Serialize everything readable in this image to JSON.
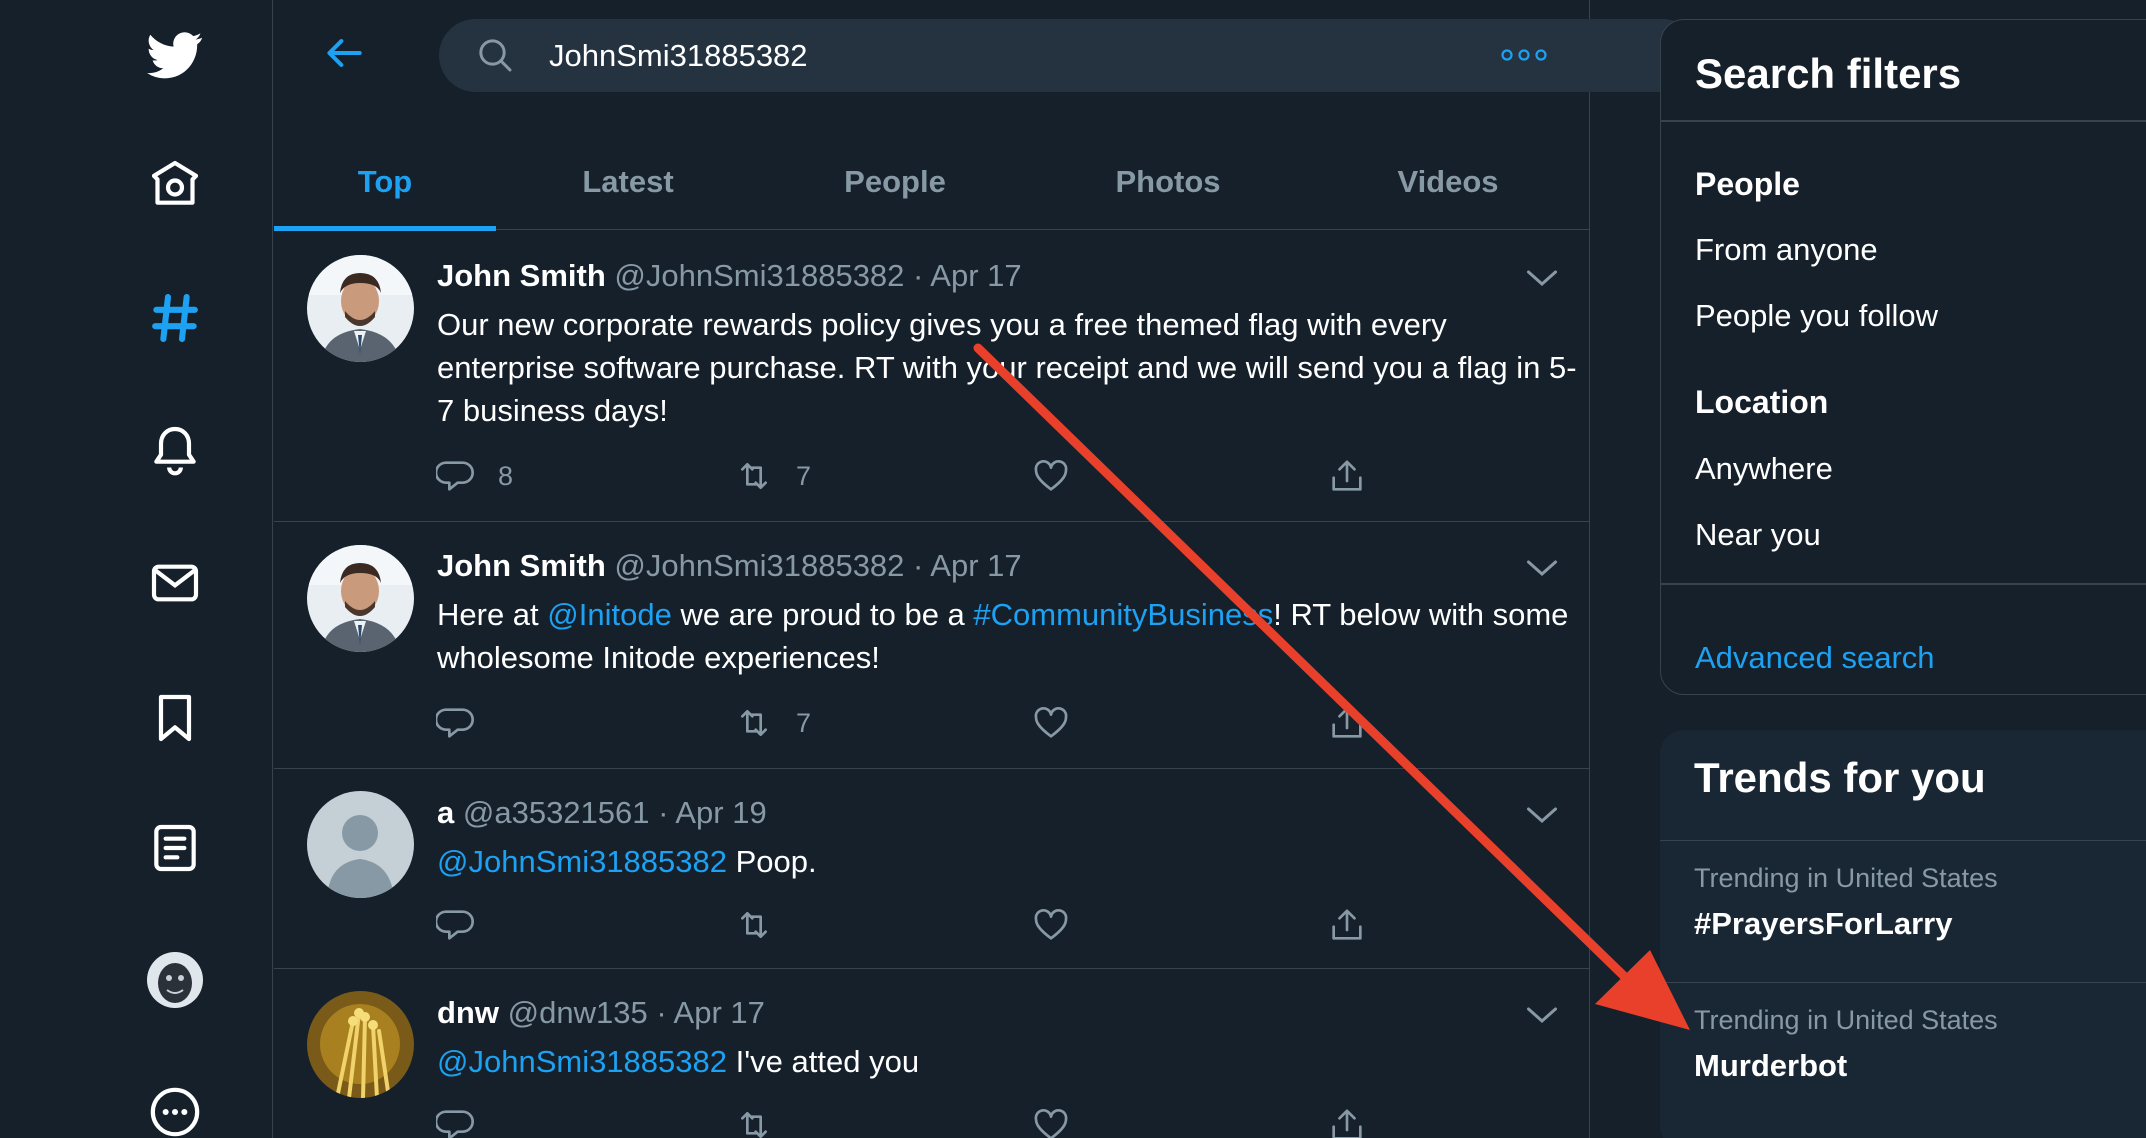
{
  "search": {
    "query": "JohnSmi31885382"
  },
  "tabs": [
    {
      "label": "Top"
    },
    {
      "label": "Latest"
    },
    {
      "label": "People"
    },
    {
      "label": "Photos"
    },
    {
      "label": "Videos"
    }
  ],
  "tweets": [
    {
      "name": "John Smith",
      "handle": "@JohnSmi31885382",
      "sep": "·",
      "date": "Apr 17",
      "body": "Our new corporate rewards policy gives you a free themed flag with every enterprise software purchase. RT with your receipt and we will send you a flag in 5-7 business days!",
      "replies": "8",
      "retweets": "7"
    },
    {
      "name": "John Smith",
      "handle": "@JohnSmi31885382",
      "sep": "·",
      "date": "Apr 17",
      "body_1": "Here at ",
      "mention": "@Initode",
      "body_2": " we are proud to be a ",
      "hashtag": "#CommunityBusiness",
      "body_3": "! RT below with some wholesome Initode experiences!",
      "retweets": "7"
    },
    {
      "name": "a",
      "handle": "@a35321561",
      "sep": "·",
      "date": "Apr 19",
      "mention": "@JohnSmi31885382",
      "body": " Poop."
    },
    {
      "name": "dnw",
      "handle": "@dnw135",
      "sep": "·",
      "date": "Apr 17",
      "mention": "@JohnSmi31885382",
      "body": " I've atted you"
    }
  ],
  "filters": {
    "title": "Search filters",
    "people_label": "People",
    "from_anyone": "From anyone",
    "people_you_follow": "People you follow",
    "location_label": "Location",
    "anywhere": "Anywhere",
    "near_you": "Near you",
    "advanced_search": "Advanced search"
  },
  "trends": {
    "title": "Trends for you",
    "items": [
      {
        "meta": "Trending in United States",
        "name": "#PrayersForLarry"
      },
      {
        "meta": "Trending in United States",
        "name": "Murderbot"
      }
    ]
  },
  "icons": {
    "nav": [
      "twitter-logo-icon",
      "home-icon",
      "explore-hashtag-icon",
      "notifications-bell-icon",
      "messages-mail-icon",
      "bookmarks-icon",
      "lists-icon",
      "profile-avatar",
      "more-options-icon"
    ],
    "tweet_actions": [
      "reply-icon",
      "retweet-icon",
      "like-icon",
      "share-icon"
    ]
  },
  "colors": {
    "background": "#15202b",
    "accent": "#1da1f2",
    "secondary_text": "#8899a6",
    "border": "#38444d",
    "annotation_arrow": "#e8402a"
  }
}
